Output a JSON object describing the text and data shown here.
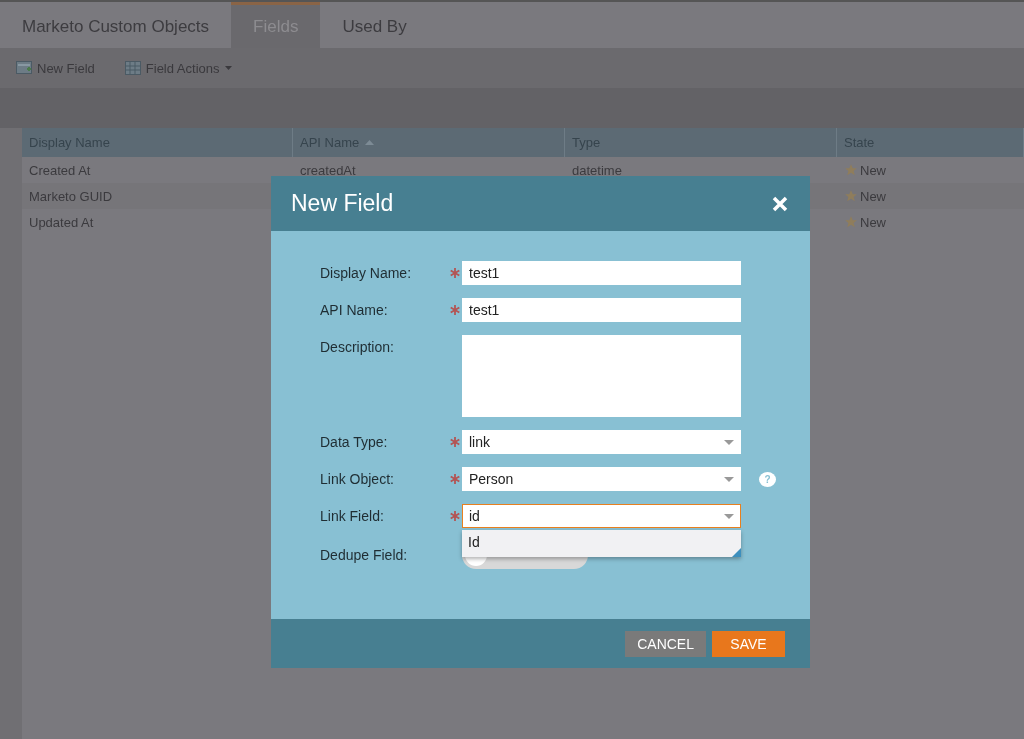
{
  "tabs": [
    {
      "label": "Marketo Custom Objects",
      "selected": false
    },
    {
      "label": "Fields",
      "selected": true
    },
    {
      "label": "Used By",
      "selected": false
    }
  ],
  "toolbar": [
    {
      "label": "New Field",
      "kind": "new",
      "menu": false
    },
    {
      "label": "Field Actions",
      "kind": "actions",
      "menu": true
    }
  ],
  "table": {
    "columns": [
      {
        "label": "Display Name",
        "sorted": false
      },
      {
        "label": "API Name",
        "sorted": true
      },
      {
        "label": "Type",
        "sorted": false
      },
      {
        "label": "State",
        "sorted": false
      }
    ],
    "rows": [
      {
        "display_name": "Created At",
        "api_name": "createdAt",
        "type": "datetime",
        "state": "New"
      },
      {
        "display_name": "Marketo GUID",
        "state": "New"
      },
      {
        "display_name": "Updated At",
        "state": "New"
      }
    ]
  },
  "dialog": {
    "title": "New Field",
    "fields": [
      {
        "kind": "text",
        "label": "Display Name:",
        "required": true,
        "value": "test1"
      },
      {
        "kind": "text",
        "label": "API Name:",
        "required": true,
        "value": "test1"
      },
      {
        "kind": "textarea",
        "label": "Description:",
        "required": false
      },
      {
        "kind": "select",
        "label": "Data Type:",
        "required": true,
        "value": "link"
      },
      {
        "kind": "select",
        "label": "Link Object:",
        "required": true,
        "value": "Person",
        "help": "?"
      },
      {
        "kind": "select",
        "label": "Link Field:",
        "required": true,
        "value": "id",
        "focused": true,
        "options": [
          "Id"
        ]
      },
      {
        "kind": "toggle",
        "label": "Dedupe Field:",
        "required": false,
        "on": false
      }
    ],
    "buttons": [
      {
        "label": "CANCEL",
        "kind": "secondary"
      },
      {
        "label": "SAVE",
        "kind": "primary"
      }
    ]
  }
}
